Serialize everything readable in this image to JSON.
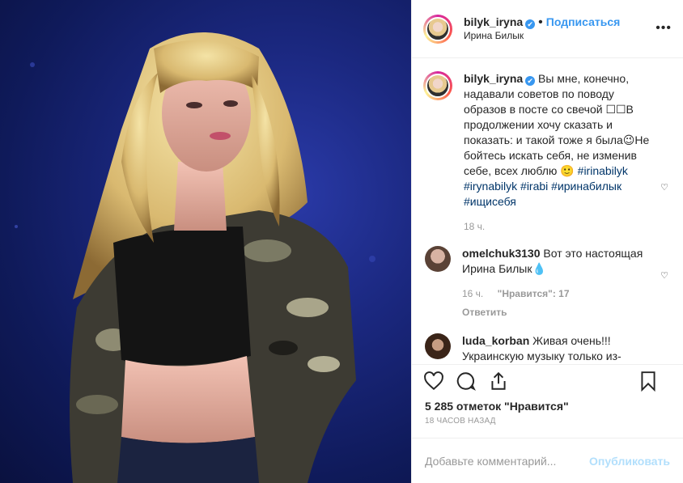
{
  "header": {
    "username": "bilyk_iryna",
    "verified_glyph": "✔",
    "separator": "•",
    "follow_label": "Подписаться",
    "location": "Ирина Билык",
    "more_label": "•••"
  },
  "caption": {
    "username": "bilyk_iryna",
    "text": "Вы мне, конечно, надавали советов по поводу образов в посте со свечой ☐☐В продолжении хочу сказать и показать: и такой тоже я была😉Не бойтесь искать себя, не изменив себе, всех люблю 🙂",
    "hashtags": "#irinabilyk #irynabilyk #irabi #иринабилык #ищисебя",
    "time": "18 ч."
  },
  "comments": [
    {
      "username": "omelchuk3130",
      "text": "Вот это настоящая Ирина Билык💧",
      "time": "16 ч.",
      "likes": "\"Нравится\": 17",
      "reply": "Ответить"
    },
    {
      "username": "luda_korban",
      "text": "Живая очень!!! Украинскую музыку только из-"
    }
  ],
  "actions": {
    "like_icon": "heart-icon",
    "comment_icon": "comment-icon",
    "share_icon": "share-icon",
    "save_icon": "bookmark-icon"
  },
  "likes_text": "5 285 отметок \"Нравится\"",
  "timestamp": "18 ЧАСОВ НАЗАД",
  "add_comment": {
    "placeholder": "Добавьте комментарий...",
    "publish_label": "Опубликовать"
  },
  "colors": {
    "accent": "#3897f0",
    "hashtag": "#003569",
    "muted": "#999999",
    "publish_disabled": "#b2dffc"
  }
}
